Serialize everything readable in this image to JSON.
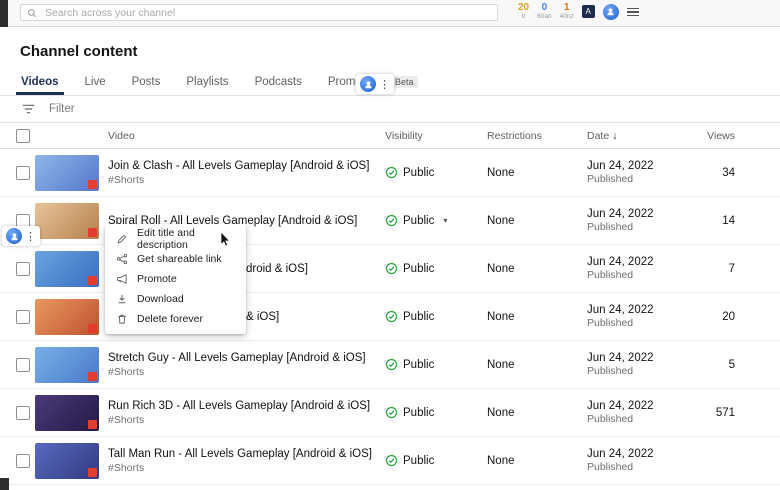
{
  "topbar": {
    "search_placeholder": "Search across your channel",
    "stats": [
      {
        "value": "20",
        "label": "t/",
        "color": "#d6a514"
      },
      {
        "value": "0",
        "label": "60an",
        "color": "#4285f4"
      },
      {
        "value": "1",
        "label": "40nz",
        "color": "#e8710a"
      }
    ],
    "badge_letter": "A"
  },
  "page_title": "Channel content",
  "tabs": {
    "items": [
      {
        "label": "Videos"
      },
      {
        "label": "Live"
      },
      {
        "label": "Posts"
      },
      {
        "label": "Playlists"
      },
      {
        "label": "Podcasts"
      },
      {
        "label": "Promotions",
        "badge": "Beta"
      }
    ]
  },
  "filter_label": "Filter",
  "ui": {
    "kebab": "⋮",
    "sort_arrow": "↓",
    "caret": "▾"
  },
  "table": {
    "headers": {
      "video": "Video",
      "visibility": "Visibility",
      "restrictions": "Restrictions",
      "date": "Date",
      "views": "Views"
    },
    "rows": [
      {
        "title": "Join & Clash - All Levels Gameplay [Android & iOS]",
        "subtitle": "#Shorts",
        "visibility": "Public",
        "restrictions": "None",
        "date": "Jun 24, 2022",
        "date_status": "Published",
        "views": "34",
        "thumb": [
          "#8fb6e8",
          "#5577cc"
        ]
      },
      {
        "title": "Spiral Roll - All Levels Gameplay [Android & iOS]",
        "subtitle": "",
        "visibility": "Public",
        "restrictions": "None",
        "date": "Jun 24, 2022",
        "date_status": "Published",
        "views": "14",
        "thumb": [
          "#e8c49a",
          "#b5804d"
        ]
      },
      {
        "title_fragment": "droid & iOS]",
        "visibility": "Public",
        "restrictions": "None",
        "date": "Jun 24, 2022",
        "date_status": "Published",
        "views": "7",
        "thumb": [
          "#6aa3e0",
          "#3a6fc0"
        ]
      },
      {
        "title_fragment": "& iOS]",
        "visibility": "Public",
        "restrictions": "None",
        "date": "Jun 24, 2022",
        "date_status": "Published",
        "views": "20",
        "thumb": [
          "#e89a60",
          "#c05030"
        ]
      },
      {
        "title": "Stretch Guy - All Levels Gameplay [Android & iOS]",
        "subtitle": "#Shorts",
        "visibility": "Public",
        "restrictions": "None",
        "date": "Jun 24, 2022",
        "date_status": "Published",
        "views": "5",
        "thumb": [
          "#7ab0e8",
          "#4878c8"
        ]
      },
      {
        "title": "Run Rich 3D - All Levels Gameplay [Android & iOS]",
        "subtitle": "#Shorts",
        "visibility": "Public",
        "restrictions": "None",
        "date": "Jun 24, 2022",
        "date_status": "Published",
        "views": "571",
        "thumb": [
          "#4a3a7a",
          "#241a45"
        ]
      },
      {
        "title": "Tall Man Run - All Levels Gameplay [Android & iOS]",
        "subtitle": "#Shorts",
        "visibility": "Public",
        "restrictions": "None",
        "date": "Jun 24, 2022",
        "date_status": "Published",
        "views": "",
        "thumb": [
          "#5a6ac0",
          "#303a80"
        ]
      }
    ]
  },
  "context_menu": {
    "items": [
      {
        "icon": "pencil-icon",
        "label": "Edit title and description"
      },
      {
        "icon": "share-icon",
        "label": "Get shareable link"
      },
      {
        "icon": "megaphone-icon",
        "label": "Promote"
      },
      {
        "icon": "download-icon",
        "label": "Download"
      },
      {
        "icon": "trash-icon",
        "label": "Delete forever"
      }
    ]
  },
  "colors": {
    "active_tab": "#1c3058",
    "public_green": "#2ba640",
    "thumbnail_logo_red": "#e23d2e"
  }
}
